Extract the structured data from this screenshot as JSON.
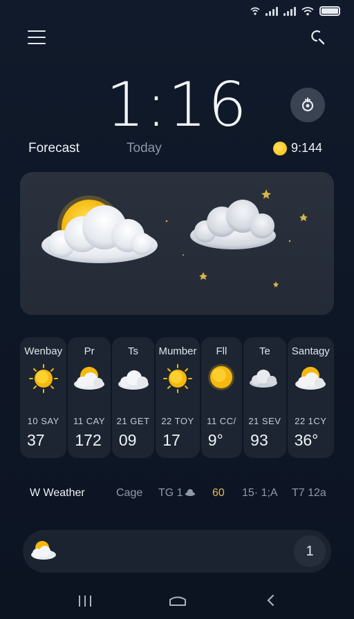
{
  "header": {
    "time": "1:16",
    "tabs": {
      "forecast": "Forecast",
      "today": "Today"
    },
    "sun_time": "9:144"
  },
  "icons": {
    "menu": "menu-icon",
    "search": "search-icon",
    "location": "location-icon",
    "sun": "sun-icon",
    "cloud": "cloud-icon",
    "partly_cloudy": "partly-cloudy-icon"
  },
  "days": [
    {
      "name": "Wenbay",
      "sub": "10  SAY",
      "temp": "37",
      "icon": "sun"
    },
    {
      "name": "Pr",
      "sub": "11  CAY",
      "temp": "172",
      "icon": "partly"
    },
    {
      "name": "Ts",
      "sub": "21  GET",
      "temp": "09",
      "icon": "cloud"
    },
    {
      "name": "Mumber",
      "sub": "22  TOY",
      "temp": "17",
      "icon": "sun"
    },
    {
      "name": "Fll",
      "sub": "11  CC/",
      "temp": "9°",
      "icon": "sunball"
    },
    {
      "name": "Te",
      "sub": "21  SEV",
      "temp": "93",
      "icon": "cloud"
    },
    {
      "name": "Santagy",
      "sub": "22  1CY",
      "temp": "36°",
      "icon": "partly"
    }
  ],
  "footer": {
    "weather": "W Weather",
    "cage": "Cage",
    "tg": "TG 1",
    "sixty": "60",
    "fifteen": "15· 1;A",
    "t7": "T7 12a"
  },
  "pill": {
    "badge": "1"
  },
  "colors": {
    "background": "#101a2a",
    "card": "#1d2532",
    "sun_yellow": "#f3b90f",
    "accent_orange": "#e8b84a",
    "muted_text": "#8f9aab"
  }
}
